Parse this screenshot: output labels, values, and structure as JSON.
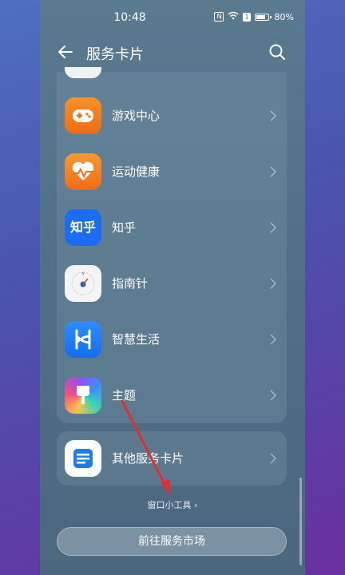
{
  "status_bar": {
    "time": "10:48",
    "nfc": "N",
    "sim": "1",
    "battery": "80%"
  },
  "header": {
    "title": "服务卡片"
  },
  "apps": [
    {
      "label": "游戏中心",
      "icon": "game-controller-icon"
    },
    {
      "label": "运动健康",
      "icon": "heart-health-icon"
    },
    {
      "label": "知乎",
      "icon": "zhihu-logo-icon"
    },
    {
      "label": "指南针",
      "icon": "compass-icon"
    },
    {
      "label": "智慧生活",
      "icon": "smart-life-icon"
    },
    {
      "label": "主题",
      "icon": "theme-brush-icon"
    }
  ],
  "other": {
    "label": "其他服务卡片",
    "icon": "document-card-icon"
  },
  "shortcut": {
    "label": "窗口小工具 ›"
  },
  "market_button": {
    "label": "前往服务市场"
  },
  "zhihu_logo_text": "知乎",
  "colors": {
    "accent_arrow": "#e0302a",
    "game": "#f07a1a",
    "health": "#f3861f",
    "zhihu": "#1a6df2",
    "smart": "#1677ff"
  }
}
